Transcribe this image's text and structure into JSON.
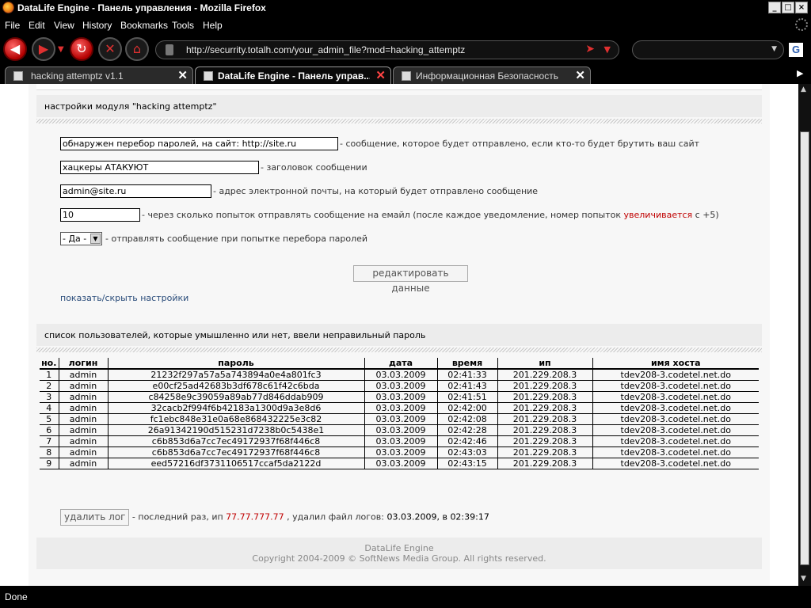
{
  "window": {
    "title": "DataLife Engine - Панель управления - Mozilla Firefox",
    "controls": {
      "minimize": "_",
      "maximize": "□",
      "close": "×"
    }
  },
  "menu": [
    "File",
    "Edit",
    "View",
    "History",
    "Bookmarks",
    "Tools",
    "Help"
  ],
  "toolbar": {
    "url": "http://securrity.totalh.com/your_admin_file?mod=hacking_attemptz",
    "search_placeholder": ""
  },
  "tabs": [
    {
      "label": "hacking attemptz v1.1",
      "active": false
    },
    {
      "label": "DataLife Engine - Панель управ...",
      "active": true
    },
    {
      "label": "Информационная Безопасность",
      "active": false
    }
  ],
  "settings": {
    "heading": "настройки модуля \"hacking attemptz\"",
    "message_value": "обнаружен перебор паролей, на сайт: http://site.ru",
    "message_desc": "- сообщение, которое будет отправлено, если кто-то будет брутить ваш сайт",
    "subject_value": "хацкеры АТАКУЮТ",
    "subject_desc": "- заголовок сообщении",
    "email_value": "admin@site.ru",
    "email_desc": "- адрес электронной почты, на который будет отправлено сообщение",
    "attempts_value": "10",
    "attempts_desc_a": "- через сколько попыток отправлять сообщение на емайл (после каждое уведомление, номер попыток ",
    "attempts_desc_red": "увеличивается",
    "attempts_desc_b": " с +5)",
    "send_value": "- Да -",
    "send_desc": "- отправлять сообщение при попытке перебора паролей",
    "submit_label": "редактировать данные",
    "toggle_link": "показать/скрыть настройки"
  },
  "log": {
    "heading": "список пользователей, которые умышленно или нет, ввели неправильный пароль",
    "columns": [
      "но.",
      "логин",
      "пароль",
      "дата",
      "время",
      "ип",
      "имя хоста"
    ],
    "rows": [
      [
        "1",
        "admin",
        "21232f297a57a5a743894a0e4a801fc3",
        "03.03.2009",
        "02:41:33",
        "201.229.208.3",
        "tdev208-3.codetel.net.do"
      ],
      [
        "2",
        "admin",
        "e00cf25ad42683b3df678c61f42c6bda",
        "03.03.2009",
        "02:41:43",
        "201.229.208.3",
        "tdev208-3.codetel.net.do"
      ],
      [
        "3",
        "admin",
        "c84258e9c39059a89ab77d846ddab909",
        "03.03.2009",
        "02:41:51",
        "201.229.208.3",
        "tdev208-3.codetel.net.do"
      ],
      [
        "4",
        "admin",
        "32cacb2f994f6b42183a1300d9a3e8d6",
        "03.03.2009",
        "02:42:00",
        "201.229.208.3",
        "tdev208-3.codetel.net.do"
      ],
      [
        "5",
        "admin",
        "fc1ebc848e31e0a68e868432225e3c82",
        "03.03.2009",
        "02:42:08",
        "201.229.208.3",
        "tdev208-3.codetel.net.do"
      ],
      [
        "6",
        "admin",
        "26a91342190d515231d7238b0c5438e1",
        "03.03.2009",
        "02:42:28",
        "201.229.208.3",
        "tdev208-3.codetel.net.do"
      ],
      [
        "7",
        "admin",
        "c6b853d6a7cc7ec49172937f68f446c8",
        "03.03.2009",
        "02:42:46",
        "201.229.208.3",
        "tdev208-3.codetel.net.do"
      ],
      [
        "8",
        "admin",
        "c6b853d6a7cc7ec49172937f68f446c8",
        "03.03.2009",
        "02:43:03",
        "201.229.208.3",
        "tdev208-3.codetel.net.do"
      ],
      [
        "9",
        "admin",
        "eed57216df3731106517ccaf5da2122d",
        "03.03.2009",
        "02:43:15",
        "201.229.208.3",
        "tdev208-3.codetel.net.do"
      ]
    ],
    "delete_label": "удалить лог",
    "last_text_a": "- последний раз, ип ",
    "last_ip": "77.77.777.77",
    "last_text_b": " , удалил файл логов: ",
    "last_date": "03.03.2009, в 02:39:17"
  },
  "footer": {
    "line1": "DataLife Engine",
    "line2": "Copyright 2004-2009 © SoftNews Media Group. All rights reserved."
  },
  "status": "Done",
  "colors": {
    "accent_red": "#c00000",
    "link": "#2a4c7a",
    "chrome": "#000000"
  }
}
